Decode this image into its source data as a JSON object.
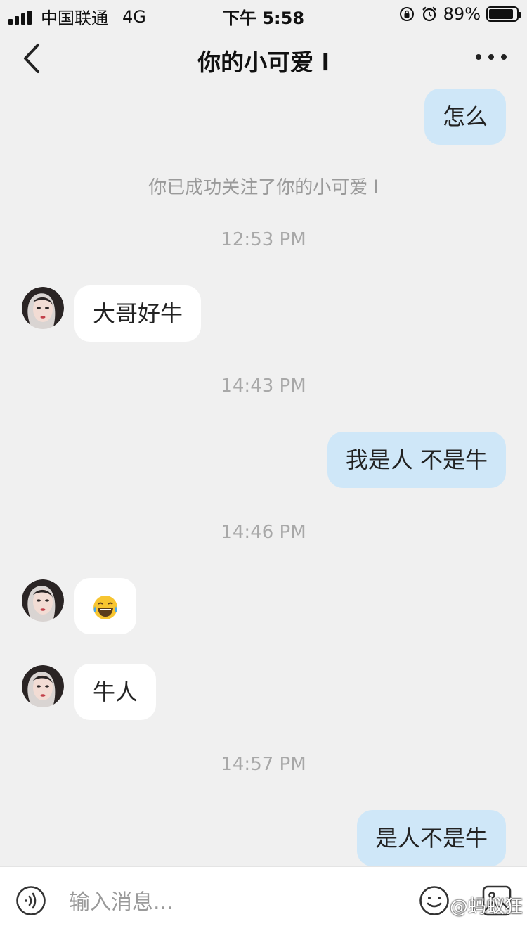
{
  "status_bar": {
    "carrier": "中国联通",
    "network": "4G",
    "time": "下午 5:58",
    "battery": "89%",
    "battery_level": 0.89
  },
  "header": {
    "title": "你的小可爱 l"
  },
  "messages": {
    "m1": "怎么",
    "system_follow": "你已成功关注了你的小可爱 l",
    "t1": "12:53 PM",
    "m2": "大哥好牛",
    "t2": "14:43 PM",
    "m3": "我是人  不是牛",
    "t3": "14:46 PM",
    "m4_emoji": "😂",
    "m5": "牛人",
    "t4": "14:57 PM",
    "m6": "是人不是牛"
  },
  "input": {
    "placeholder": "输入消息..."
  },
  "watermark": "@蚂蚁狂",
  "colors": {
    "my_bubble": "#cfe7f8",
    "other_bubble": "#ffffff",
    "background": "#f0f0f0"
  },
  "icons": {
    "back": "chevron-left-icon",
    "more": "more-dots-icon",
    "voice": "voice-icon",
    "emoji": "emoji-face-icon",
    "image": "image-icon"
  }
}
